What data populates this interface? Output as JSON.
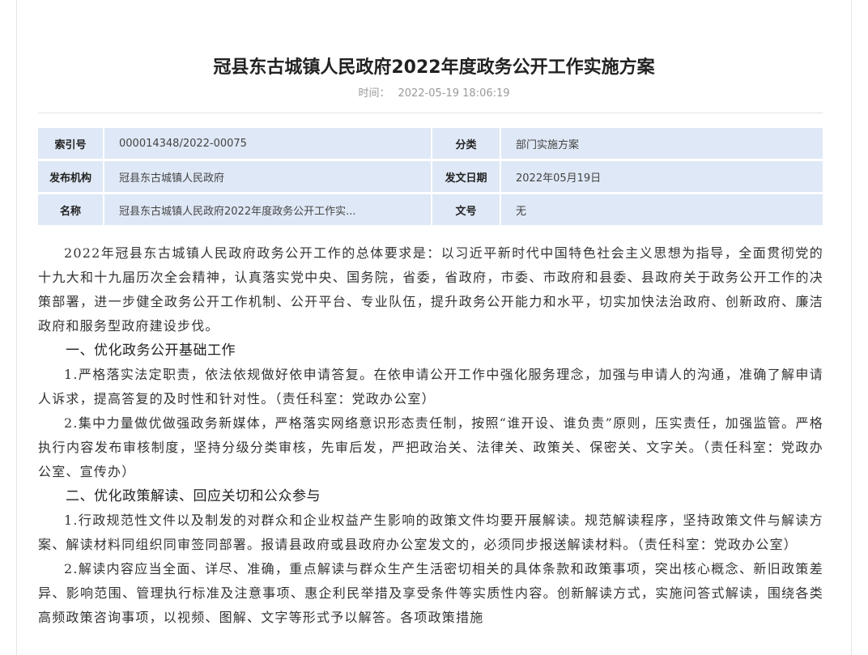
{
  "article": {
    "title": "冠县东古城镇人民政府2022年度政务公开工作实施方案",
    "time_label": "时间：",
    "time_value": "2022-05-19 18:06:19"
  },
  "meta": {
    "index_label": "索引号",
    "index_value": "000014348/2022-00075",
    "category_label": "分类",
    "category_value": "部门实施方案",
    "publisher_label": "发布机构",
    "publisher_value": "冠县东古城镇人民政府",
    "date_label": "发文日期",
    "date_value": "2022年05月19日",
    "name_label": "名称",
    "name_value": "冠县东古城镇人民政府2022年度政务公开工作实...",
    "docno_label": "文号",
    "docno_value": "无"
  },
  "content": {
    "intro": "2022年冠县东古城镇人民政府政务公开工作的总体要求是：以习近平新时代中国特色社会主义思想为指导，全面贯彻党的十九大和十九届历次全会精神，认真落实党中央、国务院，省委，省政府，市委、市政府和县委、县政府关于政务公开工作的决策部署，进一步健全政务公开工作机制、公开平台、专业队伍，提升政务公开能力和水平，切实加快法治政府、创新政府、廉洁政府和服务型政府建设步伐。",
    "section1_heading": "一、优化政务公开基础工作",
    "section1_p1": "1.严格落实法定职责，依法依规做好依申请答复。在依申请公开工作中强化服务理念，加强与申请人的沟通，准确了解申请人诉求，提高答复的及时性和针对性。（责任科室：党政办公室）",
    "section1_p2": "2.集中力量做优做强政务新媒体，严格落实网络意识形态责任制，按照“谁开设、谁负责”原则，压实责任，加强监管。严格执行内容发布审核制度，坚持分级分类审核，先审后发，严把政治关、法律关、政策关、保密关、文字关。（责任科室：党政办公室、宣传办）",
    "section2_heading": "二、优化政策解读、回应关切和公众参与",
    "section2_p1": "1.行政规范性文件以及制发的对群众和企业权益产生影响的政策文件均要开展解读。规范解读程序，坚持政策文件与解读方案、解读材料同组织同审签同部署。报请县政府或县政府办公室发文的，必须同步报送解读材料。（责任科室：党政办公室）",
    "section2_p2": "2.解读内容应当全面、详尽、准确，重点解读与群众生产生活密切相关的具体条款和政策事项，突出核心概念、新旧政策差异、影响范围、管理执行标准及注意事项、惠企利民举措及享受条件等实质性内容。创新解读方式，实施问答式解读，围绕各类高频政策咨询事项，以视频、图解、文字等形式予以解答。各项政策措施"
  }
}
